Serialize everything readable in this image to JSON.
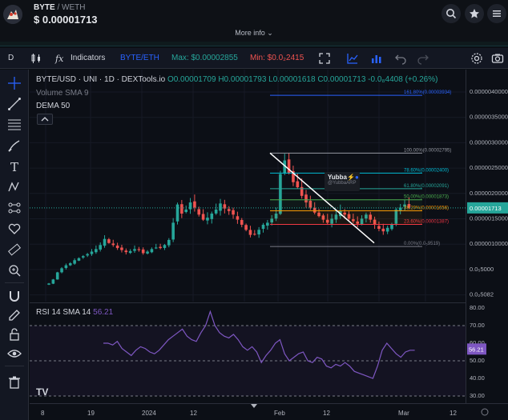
{
  "header": {
    "base": "BYTE",
    "separator": "/",
    "quote": "WETH",
    "price": "$ 0.00001713",
    "more_info": "More info"
  },
  "toolbar": {
    "interval": "D",
    "indicators": "Indicators",
    "pair": "BYTE/ETH",
    "max": "Max: $0.00002855",
    "min": "Min: $0.0₂2415"
  },
  "chart": {
    "title": "BYTE/USD · UNI · 1D · DEXTools.io",
    "ohlc": "O0.00001709 H0.00001793 L0.00001618 C0.00001713 -0.0₈4408 (+0.26%)",
    "volume_label": "Volume SMA 9",
    "dema_label": "DEMA 50",
    "watermark_name": "Yubba",
    "watermark_handle": "@YubbaARP",
    "tv_logo": "TV",
    "fib_levels": [
      {
        "label": "161.80%(0.00003934)",
        "color": "#2962ff",
        "price": 3.934e-05
      },
      {
        "label": "100.00%(0.00002795)",
        "color": "#9598a1",
        "price": 2.795e-05
      },
      {
        "label": "78.60%(0.00002400)",
        "color": "#00bcd4",
        "price": 2.4e-05
      },
      {
        "label": "61.80%(0.00002091)",
        "color": "#26a69a",
        "price": 2.091e-05
      },
      {
        "label": "50.00%(0.00001873)",
        "color": "#4caf50",
        "price": 1.873e-05
      },
      {
        "label": "38.20%(0.00001656)",
        "color": "#ff9800",
        "price": 1.656e-05
      },
      {
        "label": "23.60%(0.00001387)",
        "color": "#f23645",
        "price": 1.387e-05
      },
      {
        "label": "0.00%(0.0₅9519)",
        "color": "#787b86",
        "price": 9.5e-06
      }
    ]
  },
  "price_axis": {
    "ticks": [
      "0.0000040000",
      "0.0000035000",
      "0.0000030000",
      "0.0000025000",
      "0.0000020000",
      "0.0000015000",
      "0.0000010000",
      "0.0₅5000",
      "0.0₂5082"
    ],
    "current": "0.00001713"
  },
  "rsi": {
    "label": "RSI 14 SMA 14",
    "value": "56.21",
    "ticks": [
      "80.00",
      "70.00",
      "60.00",
      "50.00",
      "40.00",
      "30.00"
    ],
    "current": "56.21"
  },
  "time_axis": {
    "ticks": [
      "8",
      "19",
      "2024",
      "12",
      "Feb",
      "12",
      "Mar",
      "12"
    ]
  },
  "colors": {
    "up": "#26a69a",
    "down": "#ef5350",
    "rsi_line": "#7e57c2",
    "background": "#0c0f16"
  }
}
